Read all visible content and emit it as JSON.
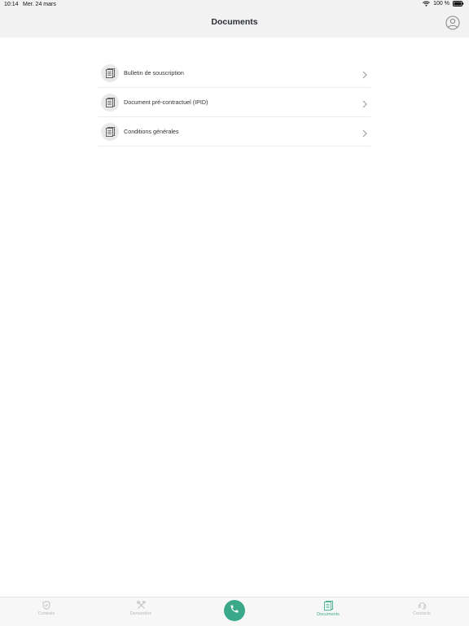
{
  "status_bar": {
    "time": "10:14",
    "date": "Mer. 24 mars",
    "battery": "100 %"
  },
  "header": {
    "title": "Documents"
  },
  "documents": [
    {
      "label": "Bulletin de souscription"
    },
    {
      "label": "Document pré-contractuel (IPID)"
    },
    {
      "label": "Conditions générales"
    }
  ],
  "tabbar": {
    "tabs": [
      {
        "label": "Contrats",
        "icon": "shield-icon"
      },
      {
        "label": "Demandes",
        "icon": "tools-icon"
      },
      {
        "label": "Documents",
        "icon": "document-icon",
        "active": true
      },
      {
        "label": "Contacts",
        "icon": "headset-icon"
      }
    ],
    "call_icon": "phone-icon"
  },
  "colors": {
    "accent": "#3dae8c",
    "call_button": "#3aa98a",
    "header_bg": "#f2f2f2"
  }
}
